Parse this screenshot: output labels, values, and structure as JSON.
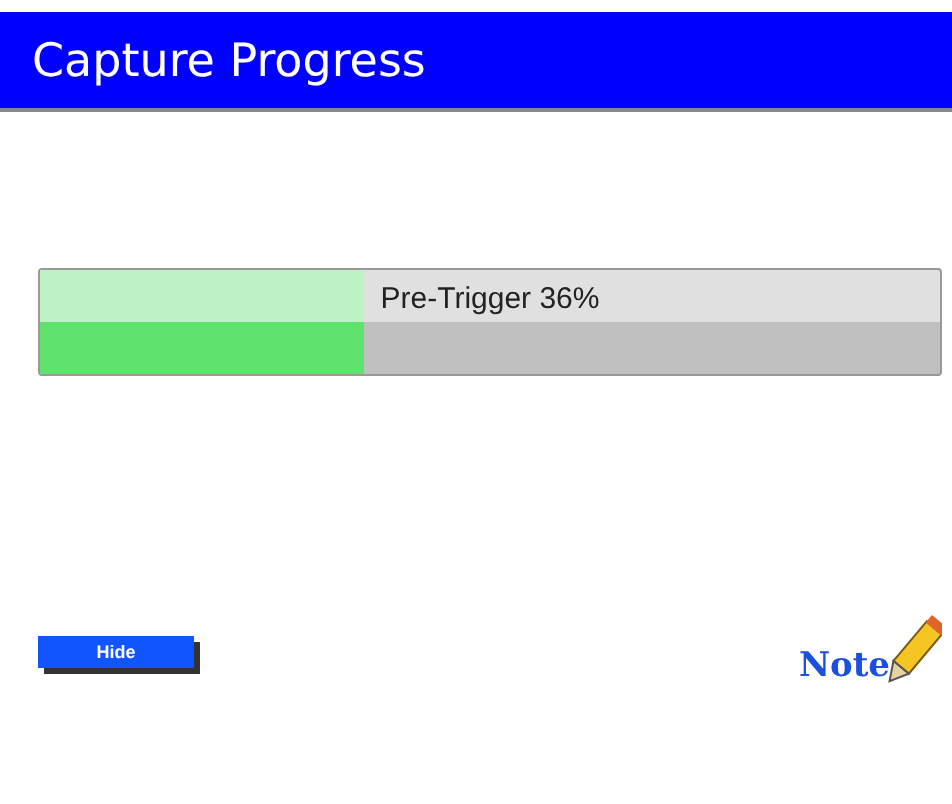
{
  "window": {
    "title": "Capture Progress"
  },
  "progress": {
    "label": "Pre-Trigger 36%",
    "level": 0.36
  },
  "buttons": [
    {
      "label": "Hide"
    }
  ],
  "note": {
    "label": "Note"
  }
}
